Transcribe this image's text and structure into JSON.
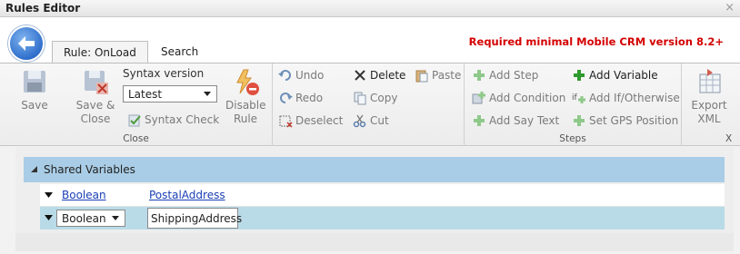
{
  "window": {
    "title": "Rules Editor",
    "close_glyph": "×"
  },
  "tabs": [
    {
      "label": "Rule: OnLoad",
      "active": true
    },
    {
      "label": "Search",
      "active": false
    }
  ],
  "requirement": "Required minimal Mobile CRM version 8.2+",
  "close_group": {
    "label": "Close",
    "save": "Save",
    "save_close_1": "Save &",
    "save_close_2": "Close",
    "syntax_label": "Syntax version",
    "syntax_value": "Latest",
    "syntax_check": "Syntax Check",
    "disable_1": "Disable",
    "disable_2": "Rule"
  },
  "edit_group": {
    "undo": "Undo",
    "redo": "Redo",
    "deselect": "Deselect",
    "delete": "Delete",
    "copy": "Copy",
    "cut": "Cut",
    "paste": "Paste"
  },
  "steps_group": {
    "label": "Steps",
    "add_step": "Add Step",
    "add_condition": "Add Condition",
    "add_say_text": "Add Say Text",
    "add_variable": "Add Variable",
    "add_if_otherwise": "Add If/Otherwise",
    "set_gps": "Set GPS Position"
  },
  "export_group": {
    "export_1": "Export",
    "export_2": "XML",
    "label_partial": "X"
  },
  "shared_variables": {
    "header": "Shared Variables",
    "rows": [
      {
        "type": "Boolean",
        "name": "PostalAddress"
      },
      {
        "type": "Boolean",
        "name": "ShippingAddress"
      }
    ]
  },
  "colors": {
    "requirement_text": "#d40000",
    "header_band": "#a9cde6",
    "selected_row": "#b9dbe7",
    "link": "#1a3fb5"
  }
}
